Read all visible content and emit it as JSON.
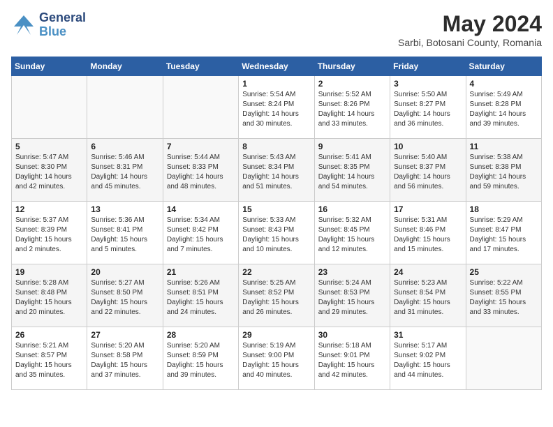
{
  "logo": {
    "line1": "General",
    "line2": "Blue"
  },
  "title": "May 2024",
  "location": "Sarbi, Botosani County, Romania",
  "headers": [
    "Sunday",
    "Monday",
    "Tuesday",
    "Wednesday",
    "Thursday",
    "Friday",
    "Saturday"
  ],
  "weeks": [
    [
      {
        "day": "",
        "info": ""
      },
      {
        "day": "",
        "info": ""
      },
      {
        "day": "",
        "info": ""
      },
      {
        "day": "1",
        "info": "Sunrise: 5:54 AM\nSunset: 8:24 PM\nDaylight: 14 hours\nand 30 minutes."
      },
      {
        "day": "2",
        "info": "Sunrise: 5:52 AM\nSunset: 8:26 PM\nDaylight: 14 hours\nand 33 minutes."
      },
      {
        "day": "3",
        "info": "Sunrise: 5:50 AM\nSunset: 8:27 PM\nDaylight: 14 hours\nand 36 minutes."
      },
      {
        "day": "4",
        "info": "Sunrise: 5:49 AM\nSunset: 8:28 PM\nDaylight: 14 hours\nand 39 minutes."
      }
    ],
    [
      {
        "day": "5",
        "info": "Sunrise: 5:47 AM\nSunset: 8:30 PM\nDaylight: 14 hours\nand 42 minutes."
      },
      {
        "day": "6",
        "info": "Sunrise: 5:46 AM\nSunset: 8:31 PM\nDaylight: 14 hours\nand 45 minutes."
      },
      {
        "day": "7",
        "info": "Sunrise: 5:44 AM\nSunset: 8:33 PM\nDaylight: 14 hours\nand 48 minutes."
      },
      {
        "day": "8",
        "info": "Sunrise: 5:43 AM\nSunset: 8:34 PM\nDaylight: 14 hours\nand 51 minutes."
      },
      {
        "day": "9",
        "info": "Sunrise: 5:41 AM\nSunset: 8:35 PM\nDaylight: 14 hours\nand 54 minutes."
      },
      {
        "day": "10",
        "info": "Sunrise: 5:40 AM\nSunset: 8:37 PM\nDaylight: 14 hours\nand 56 minutes."
      },
      {
        "day": "11",
        "info": "Sunrise: 5:38 AM\nSunset: 8:38 PM\nDaylight: 14 hours\nand 59 minutes."
      }
    ],
    [
      {
        "day": "12",
        "info": "Sunrise: 5:37 AM\nSunset: 8:39 PM\nDaylight: 15 hours\nand 2 minutes."
      },
      {
        "day": "13",
        "info": "Sunrise: 5:36 AM\nSunset: 8:41 PM\nDaylight: 15 hours\nand 5 minutes."
      },
      {
        "day": "14",
        "info": "Sunrise: 5:34 AM\nSunset: 8:42 PM\nDaylight: 15 hours\nand 7 minutes."
      },
      {
        "day": "15",
        "info": "Sunrise: 5:33 AM\nSunset: 8:43 PM\nDaylight: 15 hours\nand 10 minutes."
      },
      {
        "day": "16",
        "info": "Sunrise: 5:32 AM\nSunset: 8:45 PM\nDaylight: 15 hours\nand 12 minutes."
      },
      {
        "day": "17",
        "info": "Sunrise: 5:31 AM\nSunset: 8:46 PM\nDaylight: 15 hours\nand 15 minutes."
      },
      {
        "day": "18",
        "info": "Sunrise: 5:29 AM\nSunset: 8:47 PM\nDaylight: 15 hours\nand 17 minutes."
      }
    ],
    [
      {
        "day": "19",
        "info": "Sunrise: 5:28 AM\nSunset: 8:48 PM\nDaylight: 15 hours\nand 20 minutes."
      },
      {
        "day": "20",
        "info": "Sunrise: 5:27 AM\nSunset: 8:50 PM\nDaylight: 15 hours\nand 22 minutes."
      },
      {
        "day": "21",
        "info": "Sunrise: 5:26 AM\nSunset: 8:51 PM\nDaylight: 15 hours\nand 24 minutes."
      },
      {
        "day": "22",
        "info": "Sunrise: 5:25 AM\nSunset: 8:52 PM\nDaylight: 15 hours\nand 26 minutes."
      },
      {
        "day": "23",
        "info": "Sunrise: 5:24 AM\nSunset: 8:53 PM\nDaylight: 15 hours\nand 29 minutes."
      },
      {
        "day": "24",
        "info": "Sunrise: 5:23 AM\nSunset: 8:54 PM\nDaylight: 15 hours\nand 31 minutes."
      },
      {
        "day": "25",
        "info": "Sunrise: 5:22 AM\nSunset: 8:55 PM\nDaylight: 15 hours\nand 33 minutes."
      }
    ],
    [
      {
        "day": "26",
        "info": "Sunrise: 5:21 AM\nSunset: 8:57 PM\nDaylight: 15 hours\nand 35 minutes."
      },
      {
        "day": "27",
        "info": "Sunrise: 5:20 AM\nSunset: 8:58 PM\nDaylight: 15 hours\nand 37 minutes."
      },
      {
        "day": "28",
        "info": "Sunrise: 5:20 AM\nSunset: 8:59 PM\nDaylight: 15 hours\nand 39 minutes."
      },
      {
        "day": "29",
        "info": "Sunrise: 5:19 AM\nSunset: 9:00 PM\nDaylight: 15 hours\nand 40 minutes."
      },
      {
        "day": "30",
        "info": "Sunrise: 5:18 AM\nSunset: 9:01 PM\nDaylight: 15 hours\nand 42 minutes."
      },
      {
        "day": "31",
        "info": "Sunrise: 5:17 AM\nSunset: 9:02 PM\nDaylight: 15 hours\nand 44 minutes."
      },
      {
        "day": "",
        "info": ""
      }
    ]
  ]
}
